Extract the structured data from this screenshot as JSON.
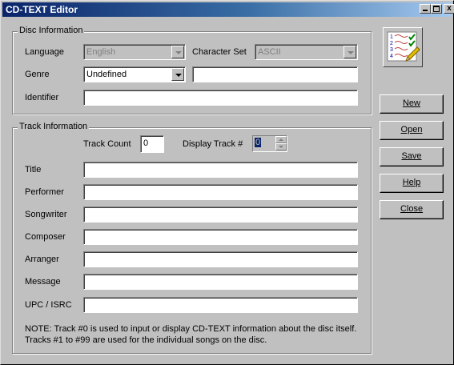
{
  "window": {
    "title": "CD-TEXT Editor",
    "close_glyph": "x"
  },
  "disc": {
    "group_label": "Disc Information",
    "language_label": "Language",
    "language_value": "English",
    "charset_label": "Character Set",
    "charset_value": "ASCII",
    "genre_label": "Genre",
    "genre_value": "Undefined",
    "genre_text": "",
    "identifier_label": "Identifier",
    "identifier_value": ""
  },
  "track": {
    "group_label": "Track Information",
    "count_label": "Track Count",
    "count_value": "0",
    "display_label": "Display Track #",
    "display_value": "0",
    "fields": [
      {
        "label": "Title",
        "value": ""
      },
      {
        "label": "Performer",
        "value": ""
      },
      {
        "label": "Songwriter",
        "value": ""
      },
      {
        "label": "Composer",
        "value": ""
      },
      {
        "label": "Arranger",
        "value": ""
      },
      {
        "label": "Message",
        "value": ""
      },
      {
        "label": "UPC / ISRC",
        "value": ""
      }
    ],
    "note_line1": "NOTE: Track #0 is used to input or display CD-TEXT information about the disc itself.",
    "note_line2": "Tracks #1 to #99 are used for the individual songs on the disc."
  },
  "buttons": {
    "new": "New",
    "open": "Open",
    "save": "Save",
    "help": "Help",
    "close": "Close"
  },
  "icon": {
    "name": "checklist-icon",
    "numbers": [
      "1",
      "2",
      "3",
      "4"
    ]
  },
  "colors": {
    "titlebar_start": "#0a246a",
    "titlebar_end": "#a6caf0",
    "face": "#c0c0c0"
  }
}
